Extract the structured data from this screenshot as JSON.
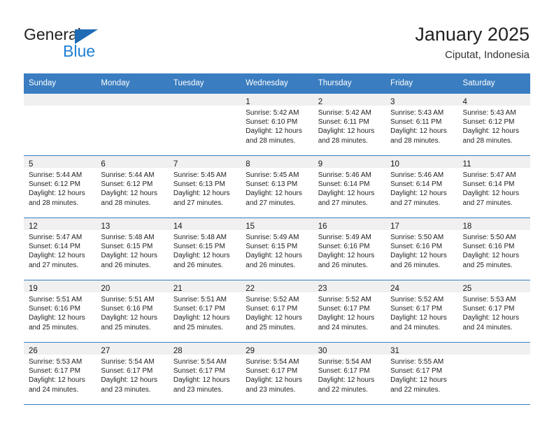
{
  "brand": {
    "name_top": "General",
    "name_bottom": "Blue",
    "triangle_color": "#1f6cb4",
    "blue_text_color": "#1f7fd4"
  },
  "header": {
    "title": "January 2025",
    "subtitle": "Ciputat, Indonesia"
  },
  "theme": {
    "header_bg": "#3a7dc0",
    "header_text": "#ffffff",
    "daynum_band_bg": "#f0f0f0",
    "cell_bg": "#ffffff",
    "row_border": "#3a7dc0"
  },
  "weekdays": [
    "Sunday",
    "Monday",
    "Tuesday",
    "Wednesday",
    "Thursday",
    "Friday",
    "Saturday"
  ],
  "weeks": [
    [
      {
        "day": "",
        "lines": []
      },
      {
        "day": "",
        "lines": []
      },
      {
        "day": "",
        "lines": []
      },
      {
        "day": "1",
        "lines": [
          "Sunrise: 5:42 AM",
          "Sunset: 6:10 PM",
          "Daylight: 12 hours",
          "and 28 minutes."
        ]
      },
      {
        "day": "2",
        "lines": [
          "Sunrise: 5:42 AM",
          "Sunset: 6:11 PM",
          "Daylight: 12 hours",
          "and 28 minutes."
        ]
      },
      {
        "day": "3",
        "lines": [
          "Sunrise: 5:43 AM",
          "Sunset: 6:11 PM",
          "Daylight: 12 hours",
          "and 28 minutes."
        ]
      },
      {
        "day": "4",
        "lines": [
          "Sunrise: 5:43 AM",
          "Sunset: 6:12 PM",
          "Daylight: 12 hours",
          "and 28 minutes."
        ]
      }
    ],
    [
      {
        "day": "5",
        "lines": [
          "Sunrise: 5:44 AM",
          "Sunset: 6:12 PM",
          "Daylight: 12 hours",
          "and 28 minutes."
        ]
      },
      {
        "day": "6",
        "lines": [
          "Sunrise: 5:44 AM",
          "Sunset: 6:12 PM",
          "Daylight: 12 hours",
          "and 28 minutes."
        ]
      },
      {
        "day": "7",
        "lines": [
          "Sunrise: 5:45 AM",
          "Sunset: 6:13 PM",
          "Daylight: 12 hours",
          "and 27 minutes."
        ]
      },
      {
        "day": "8",
        "lines": [
          "Sunrise: 5:45 AM",
          "Sunset: 6:13 PM",
          "Daylight: 12 hours",
          "and 27 minutes."
        ]
      },
      {
        "day": "9",
        "lines": [
          "Sunrise: 5:46 AM",
          "Sunset: 6:14 PM",
          "Daylight: 12 hours",
          "and 27 minutes."
        ]
      },
      {
        "day": "10",
        "lines": [
          "Sunrise: 5:46 AM",
          "Sunset: 6:14 PM",
          "Daylight: 12 hours",
          "and 27 minutes."
        ]
      },
      {
        "day": "11",
        "lines": [
          "Sunrise: 5:47 AM",
          "Sunset: 6:14 PM",
          "Daylight: 12 hours",
          "and 27 minutes."
        ]
      }
    ],
    [
      {
        "day": "12",
        "lines": [
          "Sunrise: 5:47 AM",
          "Sunset: 6:14 PM",
          "Daylight: 12 hours",
          "and 27 minutes."
        ]
      },
      {
        "day": "13",
        "lines": [
          "Sunrise: 5:48 AM",
          "Sunset: 6:15 PM",
          "Daylight: 12 hours",
          "and 26 minutes."
        ]
      },
      {
        "day": "14",
        "lines": [
          "Sunrise: 5:48 AM",
          "Sunset: 6:15 PM",
          "Daylight: 12 hours",
          "and 26 minutes."
        ]
      },
      {
        "day": "15",
        "lines": [
          "Sunrise: 5:49 AM",
          "Sunset: 6:15 PM",
          "Daylight: 12 hours",
          "and 26 minutes."
        ]
      },
      {
        "day": "16",
        "lines": [
          "Sunrise: 5:49 AM",
          "Sunset: 6:16 PM",
          "Daylight: 12 hours",
          "and 26 minutes."
        ]
      },
      {
        "day": "17",
        "lines": [
          "Sunrise: 5:50 AM",
          "Sunset: 6:16 PM",
          "Daylight: 12 hours",
          "and 26 minutes."
        ]
      },
      {
        "day": "18",
        "lines": [
          "Sunrise: 5:50 AM",
          "Sunset: 6:16 PM",
          "Daylight: 12 hours",
          "and 25 minutes."
        ]
      }
    ],
    [
      {
        "day": "19",
        "lines": [
          "Sunrise: 5:51 AM",
          "Sunset: 6:16 PM",
          "Daylight: 12 hours",
          "and 25 minutes."
        ]
      },
      {
        "day": "20",
        "lines": [
          "Sunrise: 5:51 AM",
          "Sunset: 6:16 PM",
          "Daylight: 12 hours",
          "and 25 minutes."
        ]
      },
      {
        "day": "21",
        "lines": [
          "Sunrise: 5:51 AM",
          "Sunset: 6:17 PM",
          "Daylight: 12 hours",
          "and 25 minutes."
        ]
      },
      {
        "day": "22",
        "lines": [
          "Sunrise: 5:52 AM",
          "Sunset: 6:17 PM",
          "Daylight: 12 hours",
          "and 25 minutes."
        ]
      },
      {
        "day": "23",
        "lines": [
          "Sunrise: 5:52 AM",
          "Sunset: 6:17 PM",
          "Daylight: 12 hours",
          "and 24 minutes."
        ]
      },
      {
        "day": "24",
        "lines": [
          "Sunrise: 5:52 AM",
          "Sunset: 6:17 PM",
          "Daylight: 12 hours",
          "and 24 minutes."
        ]
      },
      {
        "day": "25",
        "lines": [
          "Sunrise: 5:53 AM",
          "Sunset: 6:17 PM",
          "Daylight: 12 hours",
          "and 24 minutes."
        ]
      }
    ],
    [
      {
        "day": "26",
        "lines": [
          "Sunrise: 5:53 AM",
          "Sunset: 6:17 PM",
          "Daylight: 12 hours",
          "and 24 minutes."
        ]
      },
      {
        "day": "27",
        "lines": [
          "Sunrise: 5:54 AM",
          "Sunset: 6:17 PM",
          "Daylight: 12 hours",
          "and 23 minutes."
        ]
      },
      {
        "day": "28",
        "lines": [
          "Sunrise: 5:54 AM",
          "Sunset: 6:17 PM",
          "Daylight: 12 hours",
          "and 23 minutes."
        ]
      },
      {
        "day": "29",
        "lines": [
          "Sunrise: 5:54 AM",
          "Sunset: 6:17 PM",
          "Daylight: 12 hours",
          "and 23 minutes."
        ]
      },
      {
        "day": "30",
        "lines": [
          "Sunrise: 5:54 AM",
          "Sunset: 6:17 PM",
          "Daylight: 12 hours",
          "and 22 minutes."
        ]
      },
      {
        "day": "31",
        "lines": [
          "Sunrise: 5:55 AM",
          "Sunset: 6:17 PM",
          "Daylight: 12 hours",
          "and 22 minutes."
        ]
      },
      {
        "day": "",
        "lines": []
      }
    ]
  ]
}
